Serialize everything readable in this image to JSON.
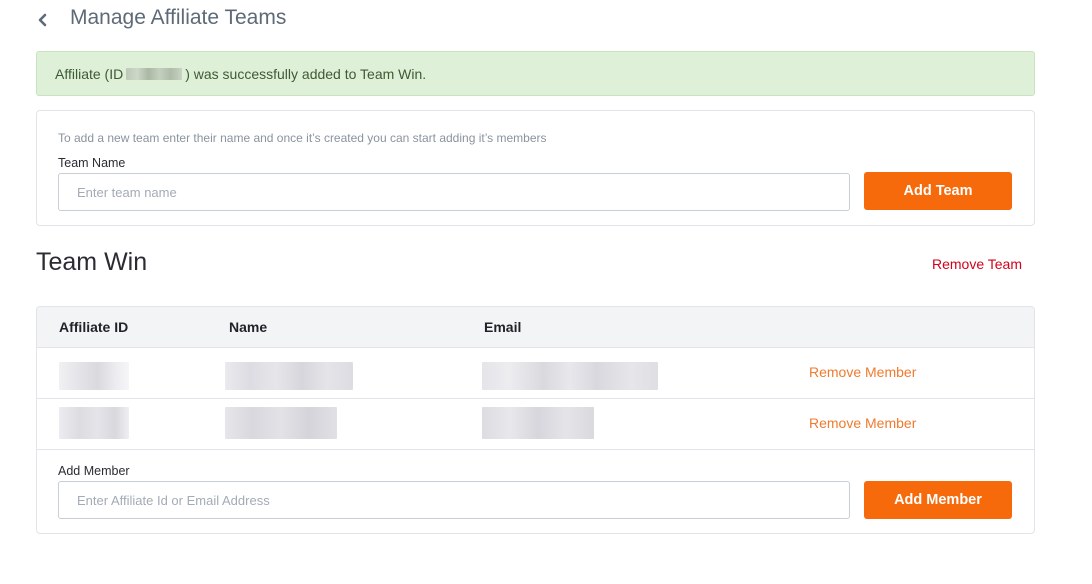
{
  "header": {
    "back_icon": "chevron-left-icon",
    "title": "Manage Affiliate Teams"
  },
  "alert": {
    "prefix": "Affiliate (ID ",
    "suffix": ") was successfully added to Team Win.",
    "color": "#dff0d8"
  },
  "add_team": {
    "hint": "To add a new team enter their name and once it’s created you can start adding it’s members",
    "label": "Team Name",
    "placeholder": "Enter team name",
    "button": "Add Team"
  },
  "team": {
    "name": "Team Win",
    "remove_label": "Remove Team",
    "columns": [
      "Affiliate ID",
      "Name",
      "Email"
    ],
    "members": [
      {
        "remove_label": "Remove Member"
      },
      {
        "remove_label": "Remove Member"
      }
    ],
    "add_member": {
      "label": "Add Member",
      "placeholder": "Enter Affiliate Id or Email Address",
      "button": "Add Member"
    }
  },
  "colors": {
    "accent": "#f76a0c",
    "danger": "#d0021b",
    "remove_member": "#f07a2e"
  }
}
